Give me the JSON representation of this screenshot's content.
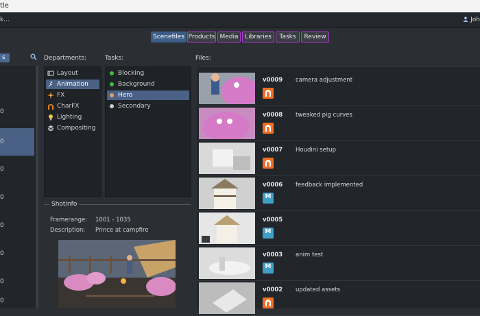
{
  "window": {
    "title": "tle"
  },
  "menubar": {
    "left": "k...",
    "user": "Joh"
  },
  "tabs": [
    {
      "label": "Scenefiles",
      "active": true
    },
    {
      "label": "Products",
      "active": false
    },
    {
      "label": "Media",
      "active": false
    },
    {
      "label": "Libraries",
      "active": false
    },
    {
      "label": "Tasks",
      "active": false
    },
    {
      "label": "Review",
      "active": false
    }
  ],
  "shots": {
    "filter_label": "s",
    "items": [
      "0",
      "0",
      "0",
      "0",
      "0",
      "0",
      "0",
      "0"
    ]
  },
  "departments": {
    "label": "Departments:",
    "items": [
      {
        "label": "Layout",
        "icon": "layout-icon"
      },
      {
        "label": "Animation",
        "icon": "animation-icon",
        "selected": true
      },
      {
        "label": "FX",
        "icon": "fx-icon"
      },
      {
        "label": "CharFX",
        "icon": "charfx-icon"
      },
      {
        "label": "Lighting",
        "icon": "lighting-icon"
      },
      {
        "label": "Compositing",
        "icon": "compositing-icon"
      }
    ]
  },
  "tasks": {
    "label": "Tasks:",
    "items": [
      {
        "label": "Blocking",
        "color": "#3fbf3f"
      },
      {
        "label": "Background",
        "color": "#3fbf3f"
      },
      {
        "label": "Hero",
        "color": "#e0a060",
        "selected": true
      },
      {
        "label": "Secondary",
        "color": "#cfcfcf"
      }
    ]
  },
  "shotinfo": {
    "title": "Shotinfo",
    "framerange_label": "Framerange:",
    "framerange_value": "1001 - 1035",
    "description_label": "Description:",
    "description_value": "Prince at campfire"
  },
  "files": {
    "label": "Files:",
    "rows": [
      {
        "version": "v0009",
        "description": "camera adjustment",
        "app": "houdini"
      },
      {
        "version": "v0008",
        "description": "tweaked pig curves",
        "app": "houdini"
      },
      {
        "version": "v0007",
        "description": "Houdini setup",
        "app": "houdini"
      },
      {
        "version": "v0006",
        "description": "feedback implemented",
        "app": "maya"
      },
      {
        "version": "v0005",
        "description": "",
        "app": "maya"
      },
      {
        "version": "v0003",
        "description": "anim test",
        "app": "maya"
      },
      {
        "version": "v0002",
        "description": "updated assets",
        "app": "houdini"
      }
    ]
  },
  "colors": {
    "accent": "#4a6185",
    "tab_border": "#b03bd0",
    "houdini": "#f36f21",
    "maya": "#3f9fc7"
  }
}
